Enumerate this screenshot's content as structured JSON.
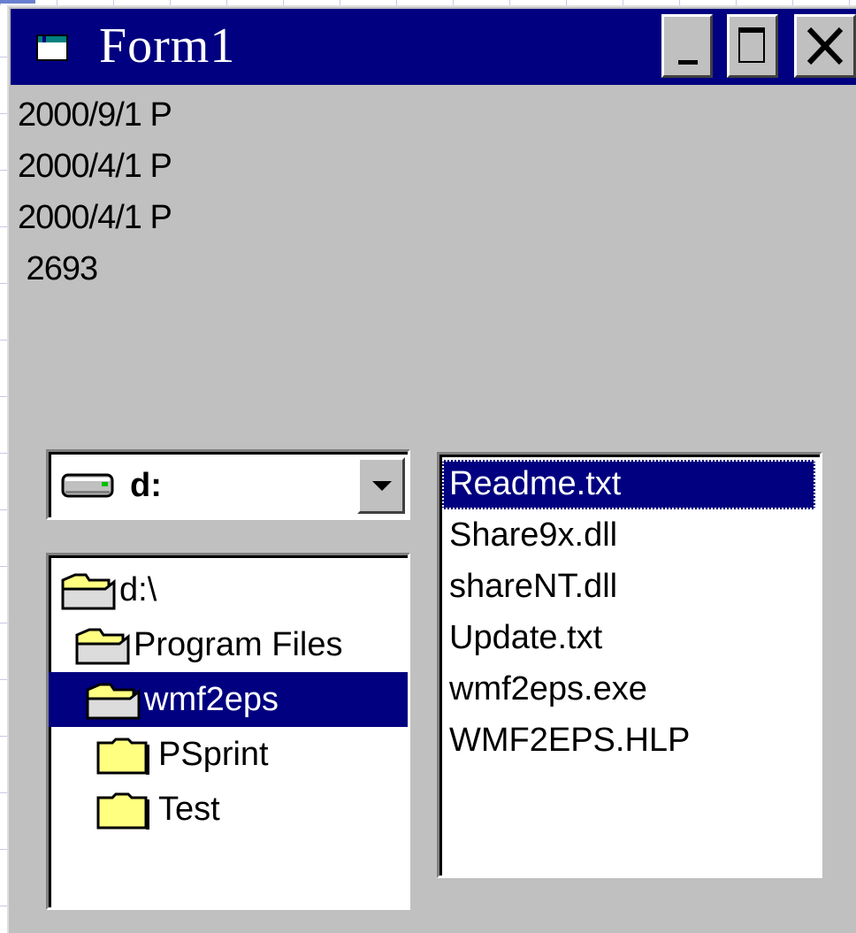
{
  "window": {
    "title": "Form1",
    "controls": {
      "minimize": "minimize",
      "maximize": "maximize",
      "close": "close"
    }
  },
  "output_lines": [
    "2000/9/1 P",
    "2000/4/1 P",
    "2000/4/1 P",
    " 2693"
  ],
  "drive_combo": {
    "value": "d:"
  },
  "directory_list": {
    "items": [
      {
        "label": "d:\\",
        "icon": "open-folder-icon",
        "selected": false
      },
      {
        "label": "Program Files",
        "icon": "open-folder-icon",
        "selected": false
      },
      {
        "label": "wmf2eps",
        "icon": "open-folder-icon",
        "selected": true
      },
      {
        "label": "PSprint",
        "icon": "folder-icon",
        "selected": false
      },
      {
        "label": "Test",
        "icon": "folder-icon",
        "selected": false
      }
    ]
  },
  "file_list": {
    "items": [
      "Readme.txt",
      "Share9x.dll",
      "shareNT.dll",
      "Update.txt",
      "wmf2eps.exe",
      "WMF2EPS.HLP"
    ],
    "selected_index": 0
  },
  "colors": {
    "face": "#c0c0c0",
    "titlebar": "#000080",
    "selection": "#000080",
    "folder": "#ffff80"
  }
}
